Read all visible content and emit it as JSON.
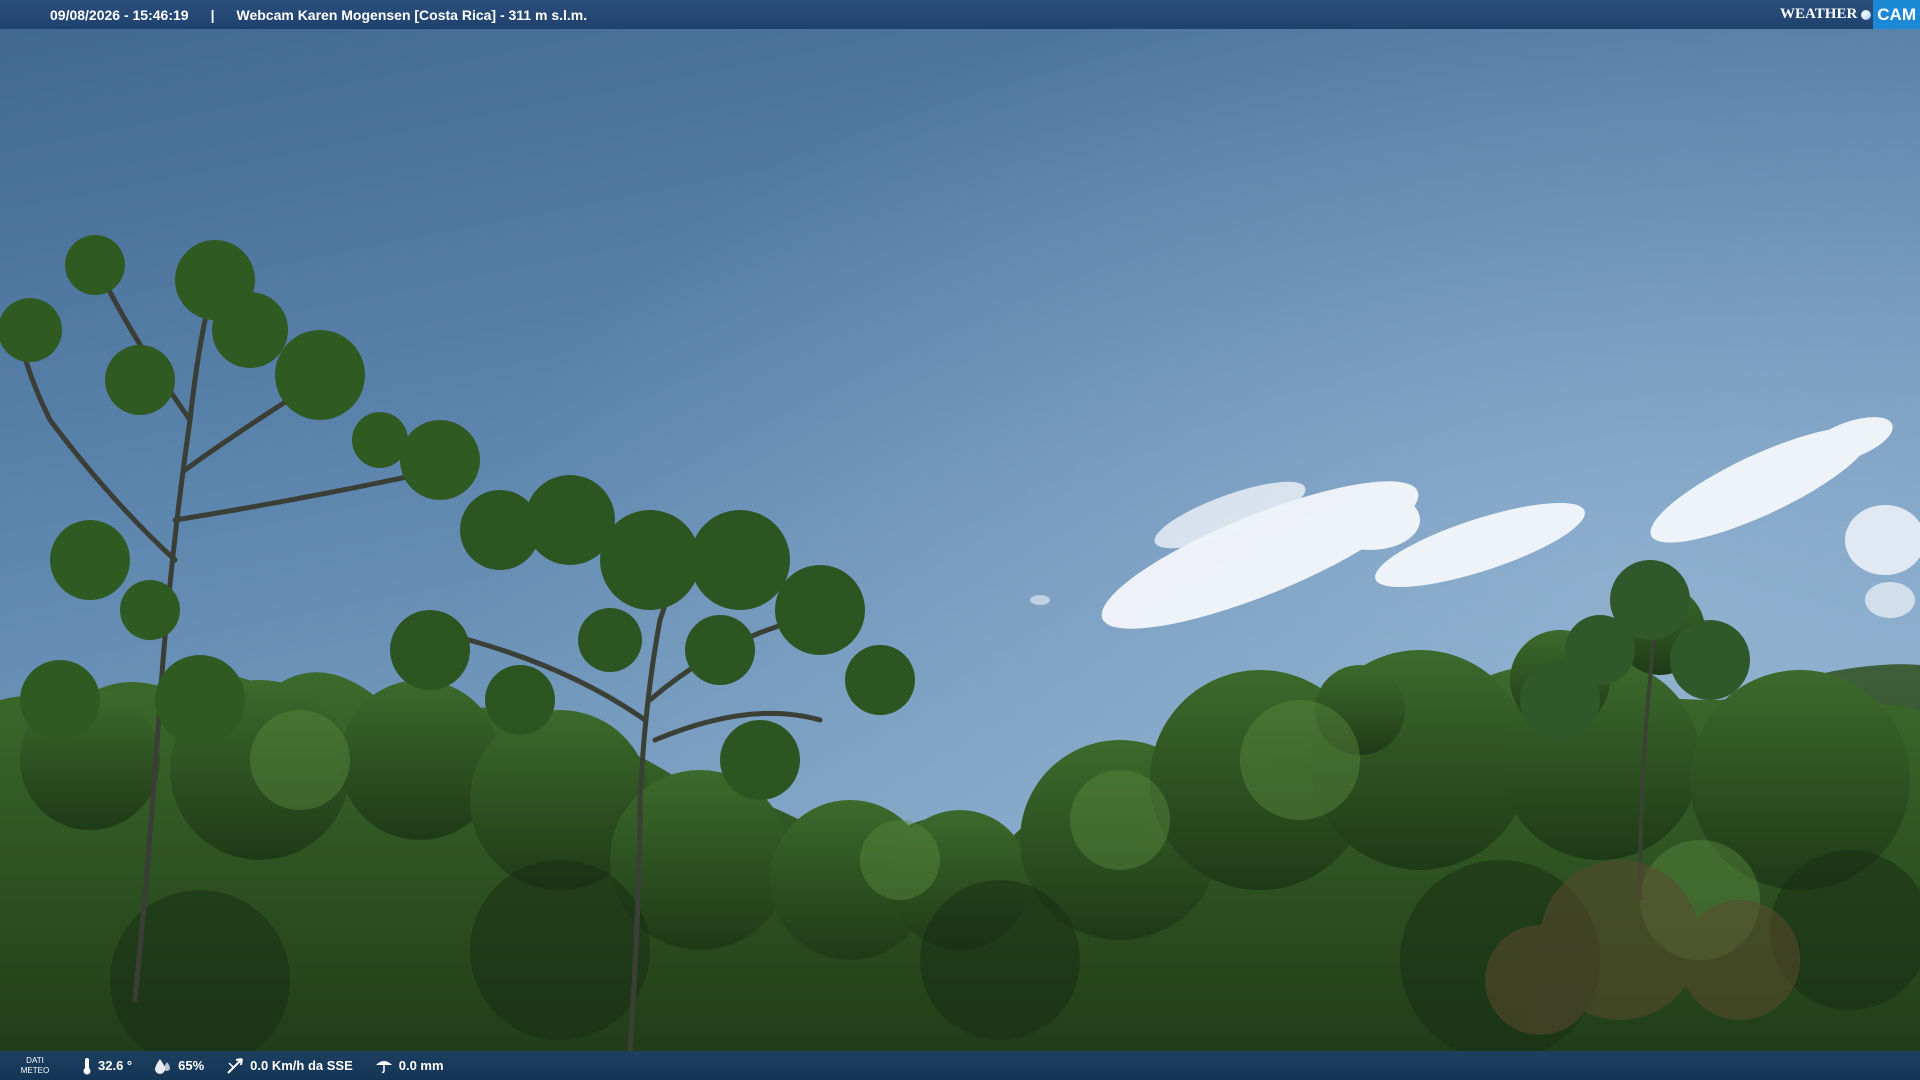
{
  "header": {
    "datetime": "09/08/2026 - 15:46:19",
    "separator": "|",
    "title": "Webcam Karen Mogensen [Costa Rica]  - 311 m s.l.m."
  },
  "brand": {
    "weather": "WEATHER",
    "cam": "CAM"
  },
  "meteo": {
    "label_line1": "DATI",
    "label_line2": "METEO",
    "temperature": "32.6 °",
    "humidity": "65%",
    "wind": "0.0 Km/h da SSE",
    "rain": "0.0 mm"
  },
  "colors": {
    "header_bg": "#1f416d",
    "brand_cam_bg": "#1c89d6",
    "sky_top": "#3e6690",
    "sky_bottom": "#7fa3c6",
    "foliage": "#2f5a24"
  }
}
